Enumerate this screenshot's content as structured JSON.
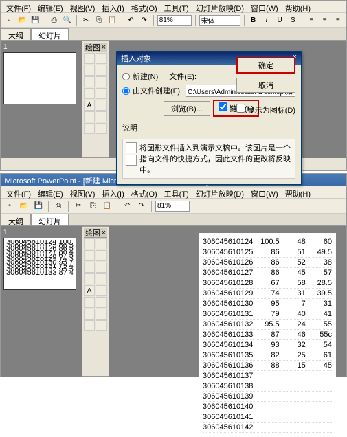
{
  "menu": {
    "file": "文件(F)",
    "edit": "编辑(E)",
    "view": "视图(V)",
    "insert": "插入(I)",
    "format": "格式(O)",
    "tools": "工具(T)",
    "slideshow": "幻灯片放映(D)",
    "window": "窗口(W)",
    "help": "帮助(H)"
  },
  "toolbar": {
    "zoom": "81%",
    "font": "宋体",
    "bold": "B",
    "italic": "I",
    "underline": "U",
    "shadow": "S"
  },
  "tabs": {
    "outline": "大纲",
    "slides": "幻灯片"
  },
  "midtools": {
    "title": "绘图"
  },
  "dialog": {
    "title": "插入对象",
    "close": "×",
    "create_new": "新建(N)",
    "from_file": "由文件创建(F)",
    "file_label": "文件(E):",
    "path": "C:\\Users\\Administrator\\Desktop\\如何在PowerPo",
    "browse": "浏览(B)...",
    "link": "链接(L)",
    "show_icon": "显示为图标(D)",
    "ok": "确定",
    "cancel": "取消",
    "desc_label": "说明",
    "desc_text": "将图形文件插入到演示文稿中。该图片是一个指向文件的快捷方式，因此文件的更改将反映中。"
  },
  "app2title": "Microsoft PowerPoint - [新建 Microsoft PowerPoint 演示文稿]",
  "data": [
    [
      "306045610124",
      "100.5",
      "48",
      "60"
    ],
    [
      "306045610125",
      "86",
      "51",
      "49.5"
    ],
    [
      "306045610126",
      "86",
      "52",
      "38"
    ],
    [
      "306045610127",
      "86",
      "45",
      "57"
    ],
    [
      "306045610128",
      "67",
      "58",
      "28.5"
    ],
    [
      "306045610129",
      "74",
      "31",
      "39.5"
    ],
    [
      "306045610130",
      "95",
      "7",
      "31"
    ],
    [
      "306045610131",
      "79",
      "40",
      "41"
    ],
    [
      "306045610132",
      "95.5",
      "24",
      "55"
    ],
    [
      "306045610133",
      "87",
      "46",
      "55c"
    ],
    [
      "306045610134",
      "93",
      "32",
      "54"
    ],
    [
      "306045610135",
      "82",
      "25",
      "61"
    ],
    [
      "306045610136",
      "88",
      "15",
      "45"
    ],
    [
      "306045610137",
      "",
      "",
      ""
    ],
    [
      "306045610138",
      "",
      "",
      ""
    ],
    [
      "306045610139",
      "",
      "",
      ""
    ],
    [
      "306045610140",
      "",
      "",
      ""
    ],
    [
      "306045610141",
      "",
      "",
      ""
    ],
    [
      "306045610142",
      "",
      "",
      ""
    ]
  ]
}
